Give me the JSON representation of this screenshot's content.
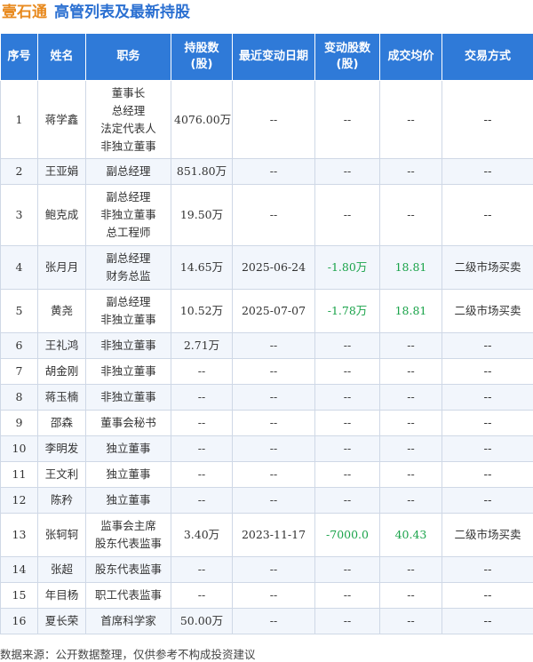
{
  "title": {
    "company": "壹石通",
    "heading": "高管列表及最新持股"
  },
  "columns": [
    "序号",
    "姓名",
    "职务",
    "持股数\n(股)",
    "最近变动日期",
    "变动股数\n(股)",
    "成交均价",
    "交易方式"
  ],
  "rows": [
    {
      "idx": "1",
      "name": "蒋学鑫",
      "positions": [
        "董事长",
        "总经理",
        "法定代表人",
        "非独立董事"
      ],
      "shares": "4076.00万",
      "date": "--",
      "change": "--",
      "price": "--",
      "method": "--",
      "h": 88
    },
    {
      "idx": "2",
      "name": "王亚娟",
      "positions": [
        "副总经理"
      ],
      "shares": "851.80万",
      "date": "--",
      "change": "--",
      "price": "--",
      "method": "--",
      "h": 29
    },
    {
      "idx": "3",
      "name": "鲍克成",
      "positions": [
        "副总经理",
        "非独立董事",
        "总工程师"
      ],
      "shares": "19.50万",
      "date": "--",
      "change": "--",
      "price": "--",
      "method": "--",
      "h": 69
    },
    {
      "idx": "4",
      "name": "张月月",
      "positions": [
        "副总经理",
        "财务总监"
      ],
      "shares": "14.65万",
      "date": "2025-06-24",
      "change": "-1.80万",
      "price": "18.81",
      "method": "二级市场买卖",
      "h": 49
    },
    {
      "idx": "5",
      "name": "黄尧",
      "positions": [
        "副总经理",
        "非独立董事"
      ],
      "shares": "10.52万",
      "date": "2025-07-07",
      "change": "-1.78万",
      "price": "18.81",
      "method": "二级市场买卖",
      "h": 49
    },
    {
      "idx": "6",
      "name": "王礼鸿",
      "positions": [
        "非独立董事"
      ],
      "shares": "2.71万",
      "date": "--",
      "change": "--",
      "price": "--",
      "method": "--",
      "h": 29
    },
    {
      "idx": "7",
      "name": "胡金刚",
      "positions": [
        "非独立董事"
      ],
      "shares": "--",
      "date": "--",
      "change": "--",
      "price": "--",
      "method": "--",
      "h": 29
    },
    {
      "idx": "8",
      "name": "蒋玉楠",
      "positions": [
        "非独立董事"
      ],
      "shares": "--",
      "date": "--",
      "change": "--",
      "price": "--",
      "method": "--",
      "h": 29
    },
    {
      "idx": "9",
      "name": "邵森",
      "positions": [
        "董事会秘书"
      ],
      "shares": "--",
      "date": "--",
      "change": "--",
      "price": "--",
      "method": "--",
      "h": 29
    },
    {
      "idx": "10",
      "name": "李明发",
      "positions": [
        "独立董事"
      ],
      "shares": "--",
      "date": "--",
      "change": "--",
      "price": "--",
      "method": "--",
      "h": 29
    },
    {
      "idx": "11",
      "name": "王文利",
      "positions": [
        "独立董事"
      ],
      "shares": "--",
      "date": "--",
      "change": "--",
      "price": "--",
      "method": "--",
      "h": 29
    },
    {
      "idx": "12",
      "name": "陈矜",
      "positions": [
        "独立董事"
      ],
      "shares": "--",
      "date": "--",
      "change": "--",
      "price": "--",
      "method": "--",
      "h": 29
    },
    {
      "idx": "13",
      "name": "张轲轲",
      "positions": [
        "监事会主席",
        "股东代表监事"
      ],
      "shares": "3.40万",
      "date": "2023-11-17",
      "change": "-7000.0",
      "price": "40.43",
      "method": "二级市场买卖",
      "h": 49
    },
    {
      "idx": "14",
      "name": "张超",
      "positions": [
        "股东代表监事"
      ],
      "shares": "--",
      "date": "--",
      "change": "--",
      "price": "--",
      "method": "--",
      "h": 29
    },
    {
      "idx": "15",
      "name": "年目杨",
      "positions": [
        "职工代表监事"
      ],
      "shares": "--",
      "date": "--",
      "change": "--",
      "price": "--",
      "method": "--",
      "h": 29
    },
    {
      "idx": "16",
      "name": "夏长荣",
      "positions": [
        "首席科学家"
      ],
      "shares": "50.00万",
      "date": "--",
      "change": "--",
      "price": "--",
      "method": "--",
      "h": 29
    }
  ],
  "footer": "数据来源：公开数据整理，仅供参考不构成投资建议",
  "colors": {
    "header_bg": "#2f7ad8",
    "company": "#e88a1f",
    "heading": "#2a6fd1",
    "green": "#1aa34a"
  }
}
